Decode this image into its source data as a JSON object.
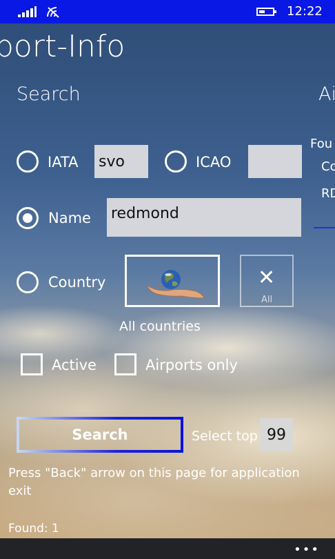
{
  "status_bar": {
    "time": "12:22",
    "icons": [
      "signal-icon",
      "wifi-icon",
      "battery-icon"
    ],
    "bg_color": "#0a18e6"
  },
  "app": {
    "title": "port-Info"
  },
  "sections": {
    "search": "Search",
    "right_partial": "Ai"
  },
  "right_panel_partial": {
    "line1": "Fou",
    "line2": "Co",
    "line3": "RD"
  },
  "iata": {
    "label": "IATA",
    "value": "svo",
    "selected": false
  },
  "icao": {
    "label": "ICAO",
    "value": "",
    "selected": false
  },
  "name": {
    "label": "Name",
    "value": "redmond",
    "selected": true
  },
  "country": {
    "label": "Country",
    "selected": false,
    "flag_icon": "globe-in-hand-icon",
    "caption": "All countries",
    "clear_button_label": "All",
    "clear_icon": "close-icon"
  },
  "filters": {
    "active_label": "Active",
    "active_checked": false,
    "airports_only_label": "Airports only",
    "airports_only_checked": false
  },
  "search_button": {
    "label": "Search"
  },
  "select_top": {
    "label": "Select top",
    "value": "99"
  },
  "hint": "Press \"Back\" arrow on this page for application exit",
  "found": "Found: 1",
  "app_bar": {
    "more_icon": "more-dots-icon"
  }
}
